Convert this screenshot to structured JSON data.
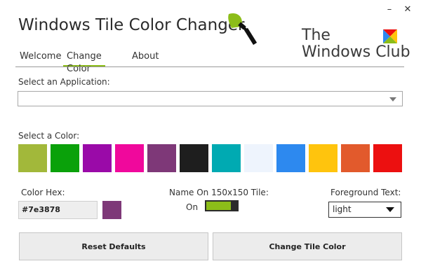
{
  "window": {
    "title": "Windows Tile Color Changer",
    "minimize_glyph": "–",
    "close_glyph": "✕"
  },
  "logo": {
    "line1": "The",
    "line2": "Windows Club",
    "brush_color": "#8cbd19",
    "icon": "paint-roller-icon",
    "emblem": "windows-flag-icon"
  },
  "tabs": [
    {
      "label": "Welcome",
      "active": false
    },
    {
      "label": "Change Color",
      "active": true
    },
    {
      "label": "About",
      "active": false
    }
  ],
  "application": {
    "label": "Select an Application:",
    "value": ""
  },
  "colors": {
    "label": "Select a Color:",
    "swatches": [
      "#a2b83a",
      "#0aa10a",
      "#9a0aa8",
      "#f0089c",
      "#7e3878",
      "#1e1e1e",
      "#00aab2",
      "#eef4fd",
      "#2d89ef",
      "#ffc40d",
      "#e25a2c",
      "#ec1010"
    ]
  },
  "hex": {
    "label": "Color Hex:",
    "value": "#7e3878",
    "preview": "#7e3878"
  },
  "tile_name": {
    "label": "Name On 150x150 Tile:",
    "state": "On",
    "accent": "#8cbd19"
  },
  "foreground": {
    "label": "Foreground Text:",
    "value": "light"
  },
  "buttons": {
    "reset": "Reset Defaults",
    "apply": "Change Tile Color"
  }
}
